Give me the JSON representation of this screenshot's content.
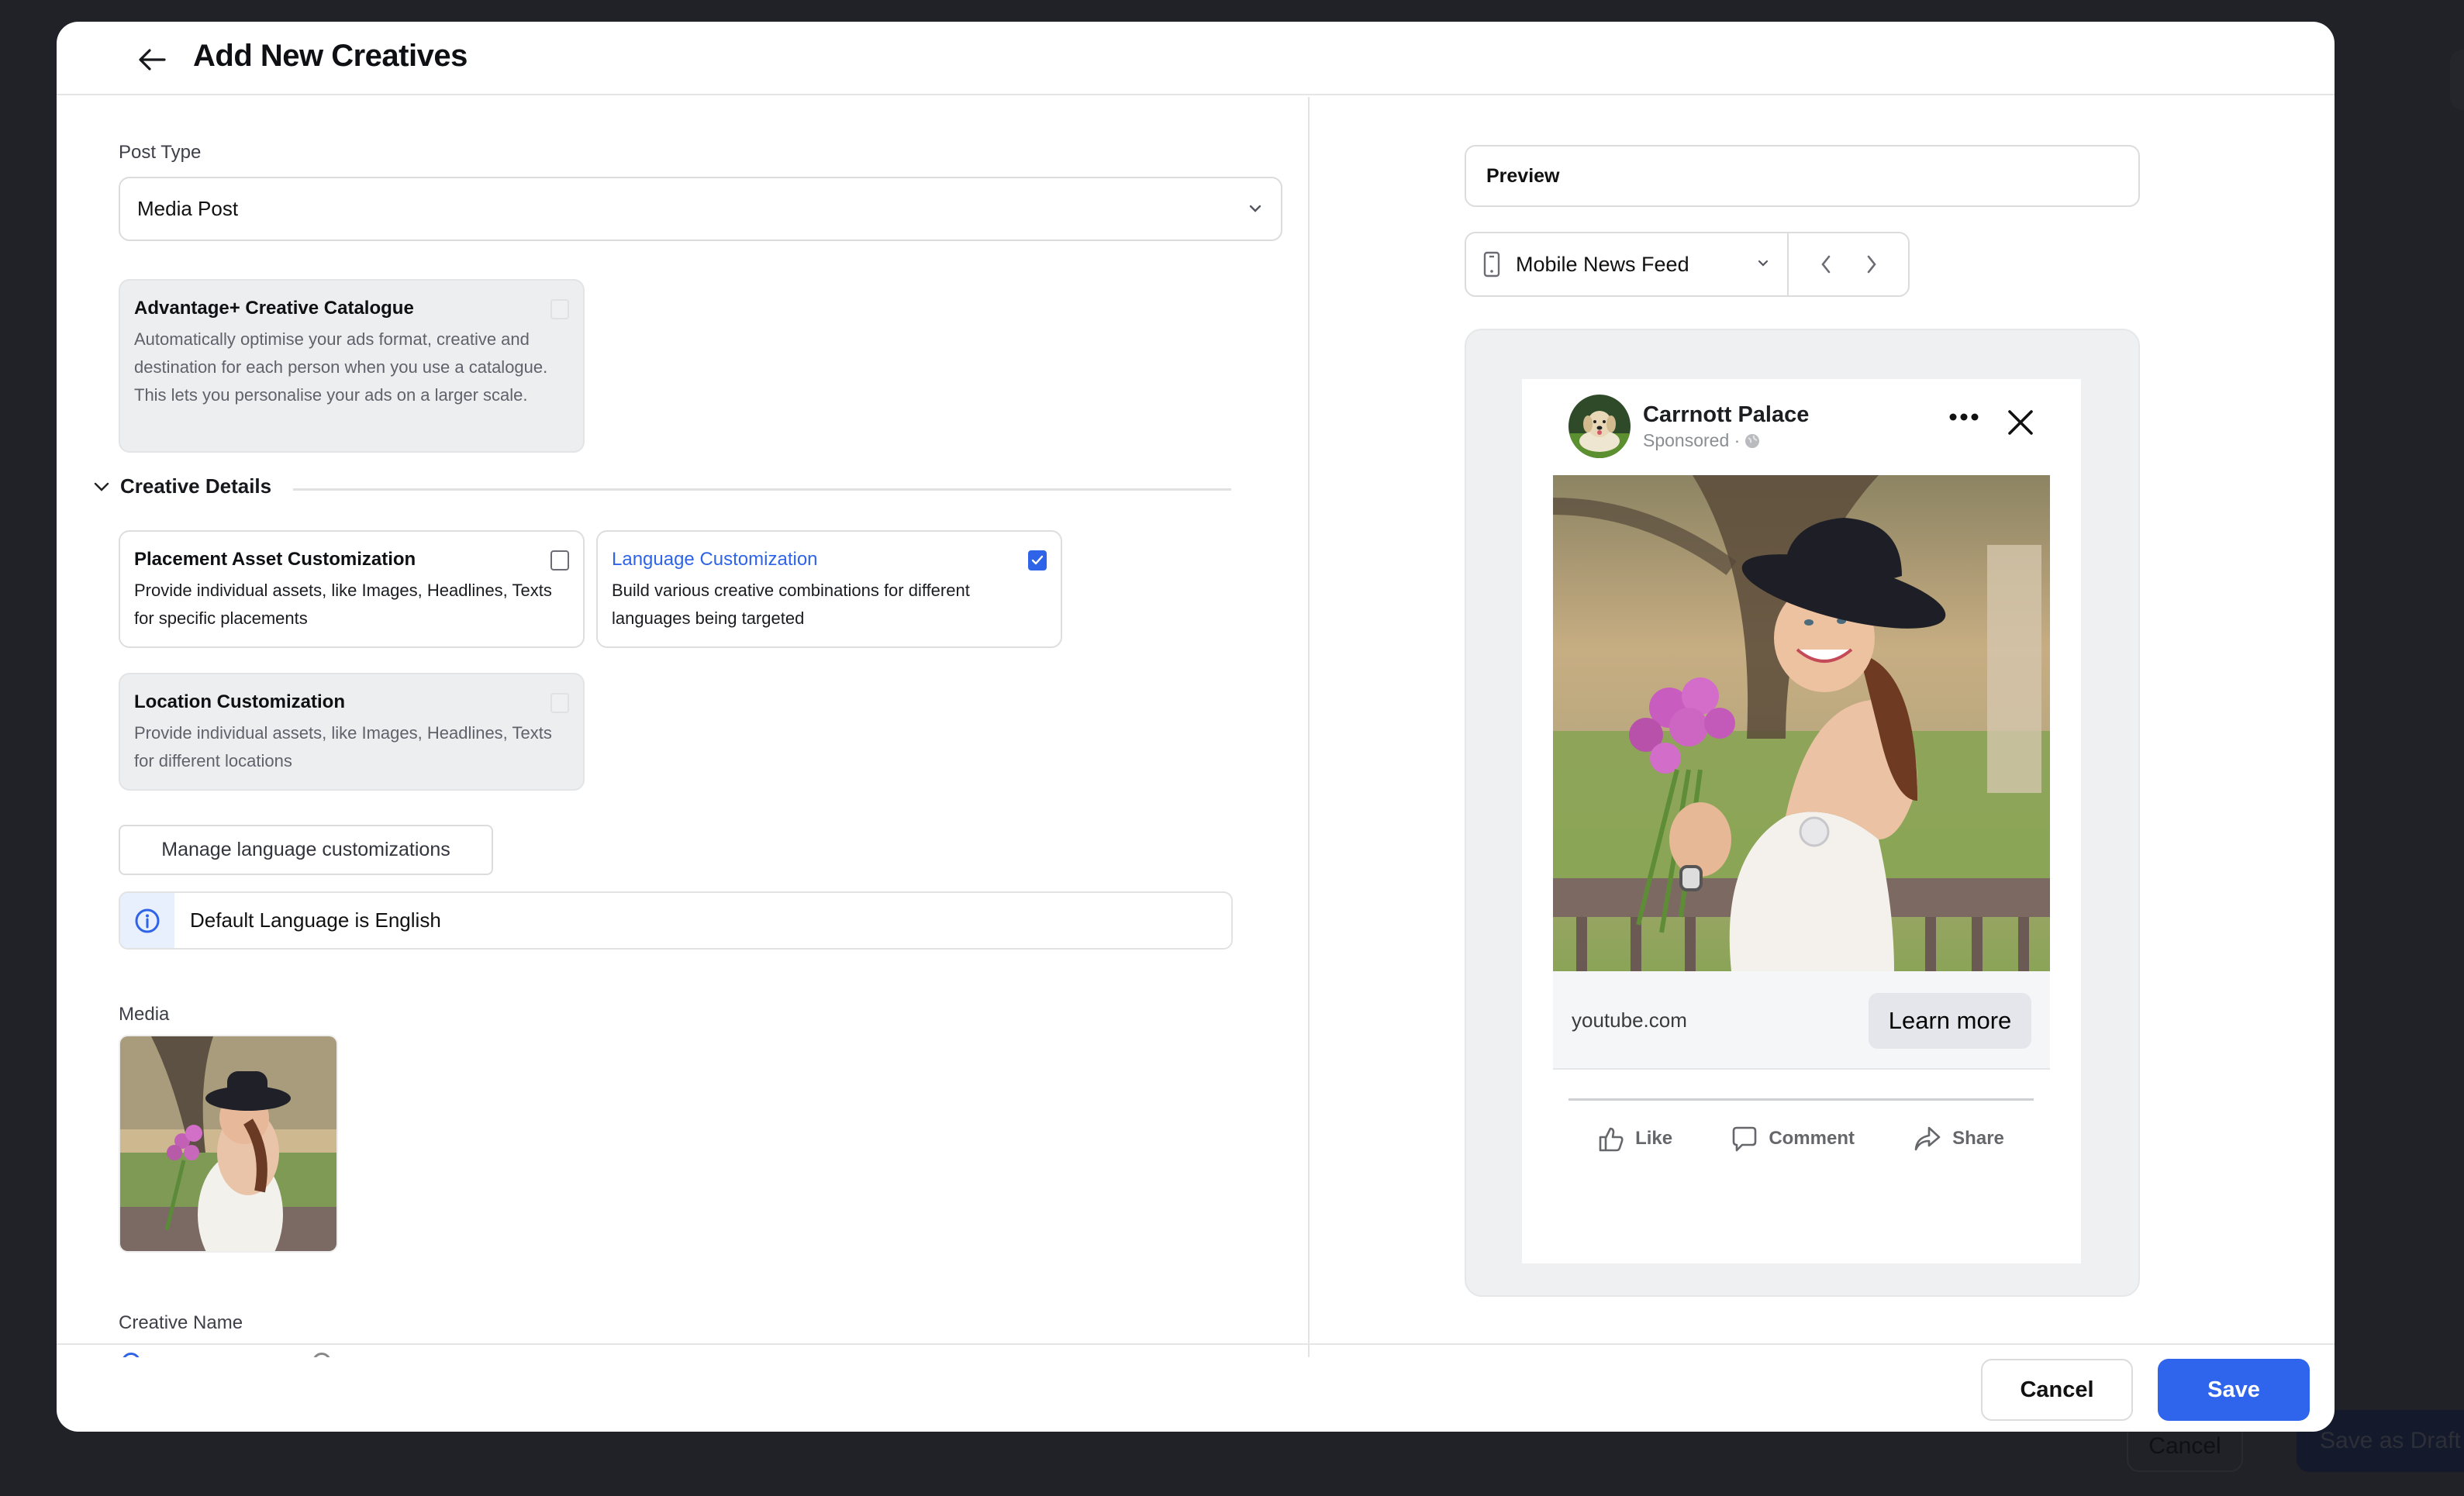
{
  "background": {
    "cancel_label": "Cancel",
    "save_draft_label": "Save as Draft"
  },
  "header": {
    "title": "Add New Creatives",
    "back_icon": "arrow-left-icon"
  },
  "form": {
    "post_type": {
      "label": "Post Type",
      "value": "Media Post"
    },
    "advantage_card": {
      "title": "Advantage+ Creative Catalogue",
      "description": "Automatically optimise your ads format, creative and destination for each person when you use a catalogue. This lets you personalise your ads on a larger scale.",
      "checked": false,
      "disabled": true
    },
    "creative_details": {
      "title": "Creative Details",
      "expanded": true,
      "options": [
        {
          "title": "Placement Asset Customization",
          "description": "Provide individual assets, like Images, Headlines, Texts for specific placements",
          "checked": false,
          "disabled": false
        },
        {
          "title": "Language Customization",
          "description": "Build various creative combinations for different languages being targeted",
          "checked": true,
          "disabled": false
        },
        {
          "title": "Location Customization",
          "description": "Provide individual assets, like Images, Headlines, Texts for different locations",
          "checked": false,
          "disabled": true
        }
      ]
    },
    "manage_language_button": "Manage language customizations",
    "info_banner": "Default Language is English",
    "media_label": "Media",
    "creative_name_label": "Creative Name"
  },
  "preview": {
    "label": "Preview",
    "placement": "Mobile News Feed",
    "post": {
      "page_name": "Carrnott Palace",
      "sponsored": "Sponsored ·",
      "domain": "youtube.com",
      "cta": "Learn more",
      "actions": [
        "Like",
        "Comment",
        "Share"
      ]
    }
  },
  "footer": {
    "cancel_label": "Cancel",
    "save_label": "Save"
  },
  "colors": {
    "accent": "#2f64ed",
    "overlay": "#212228",
    "disabled_card": "#edeef0",
    "info_bg": "#e8effd"
  }
}
